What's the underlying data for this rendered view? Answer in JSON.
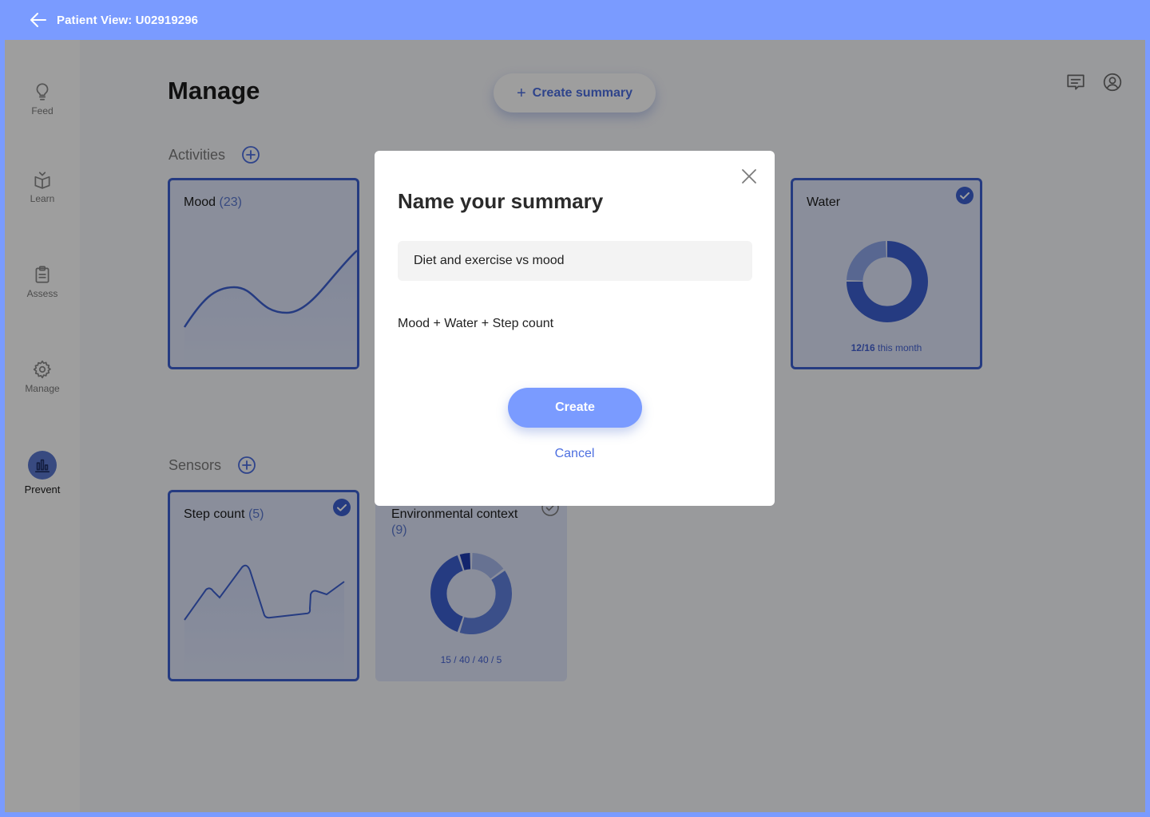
{
  "header": {
    "title": "Patient View: U02919296"
  },
  "sidebar": {
    "items": [
      {
        "label": "Feed",
        "icon": "lightbulb-icon"
      },
      {
        "label": "Learn",
        "icon": "book-icon"
      },
      {
        "label": "Assess",
        "icon": "clipboard-icon"
      },
      {
        "label": "Manage",
        "icon": "gear-icon"
      },
      {
        "label": "Prevent",
        "icon": "bar-chart-icon",
        "active": true
      }
    ]
  },
  "main": {
    "title": "Manage",
    "create_summary_label": "Create summary",
    "activities": {
      "title": "Activities",
      "cards": [
        {
          "title": "Mood",
          "count": "(23)",
          "selected": true
        },
        {
          "title": "Water",
          "selected": true,
          "progress_value": "12/16",
          "progress_suffix": " this month",
          "progress_fraction": 0.75
        }
      ]
    },
    "sensors": {
      "title": "Sensors",
      "cards": [
        {
          "title": "Step count",
          "count": "(5)",
          "selected": true
        },
        {
          "title": "Environmental context",
          "count": "(9)",
          "selected": false,
          "breakdown": "15 / 40 / 40 / 5",
          "segments": [
            15,
            40,
            40,
            5
          ]
        }
      ]
    }
  },
  "modal": {
    "title": "Name your summary",
    "name_value": "Diet and exercise vs mood",
    "combination": "Mood + Water + Step count",
    "create_label": "Create",
    "cancel_label": "Cancel"
  },
  "colors": {
    "accent": "#7a9bff",
    "primary_dark": "#3d5fd0",
    "card_bg": "#dfe6fb"
  }
}
